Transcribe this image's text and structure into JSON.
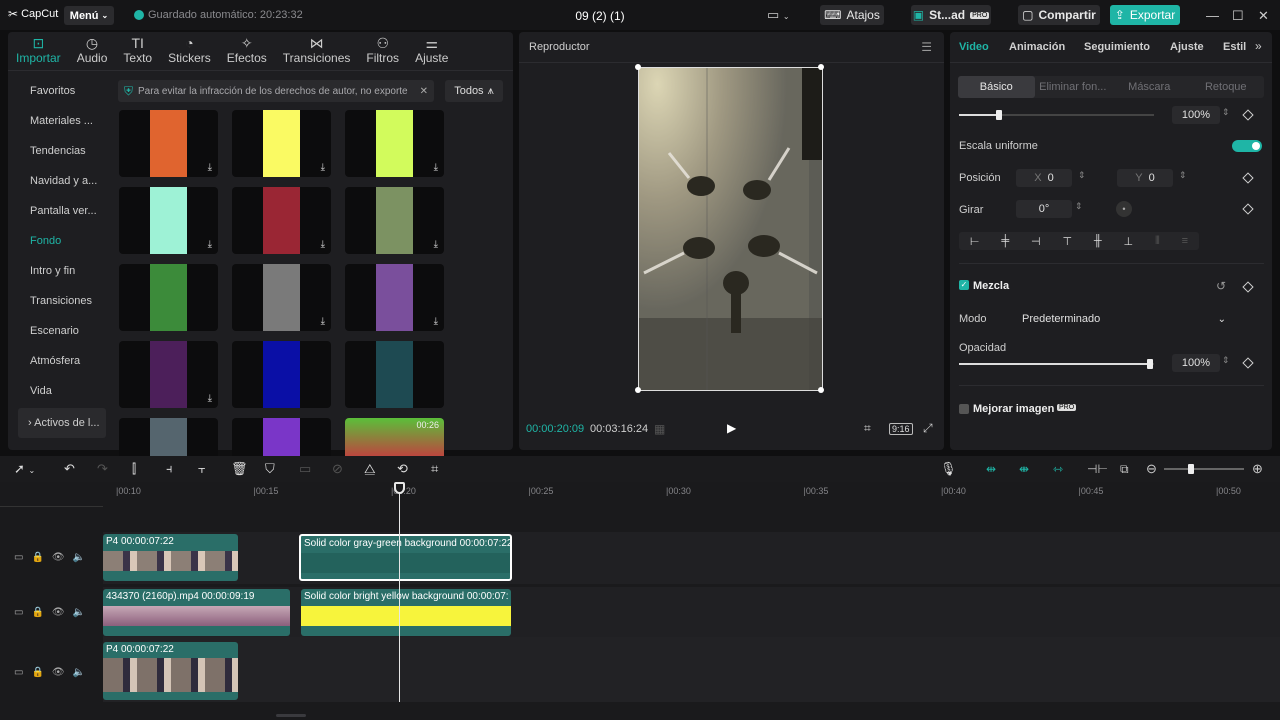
{
  "topbar": {
    "logo": "CapCut",
    "menu": "Menú",
    "autosave": "Guardado automático: 20:23:32",
    "project": "09 (2) (1)",
    "shortcuts": "Atajos",
    "studio": "St...ad",
    "pro_badge": "PRO",
    "share": "Compartir",
    "export": "Exportar"
  },
  "media_tabs": [
    {
      "label": "Importar",
      "icon": "import-icon"
    },
    {
      "label": "Audio",
      "icon": "audio-icon"
    },
    {
      "label": "Texto",
      "icon": "text-icon"
    },
    {
      "label": "Stickers",
      "icon": "sticker-icon"
    },
    {
      "label": "Efectos",
      "icon": "effects-icon"
    },
    {
      "label": "Transiciones",
      "icon": "transitions-icon"
    },
    {
      "label": "Filtros",
      "icon": "filters-icon"
    },
    {
      "label": "Ajuste",
      "icon": "adjust-icon"
    }
  ],
  "sidebar": [
    "Favoritos",
    "Materiales ...",
    "Tendencias",
    "Navidad y a...",
    "Pantalla ver...",
    "Fondo",
    "Intro y fin",
    "Transiciones",
    "Escenario",
    "Atmósfera",
    "Vida",
    "Activos de l..."
  ],
  "sidebar_active": "Fondo",
  "notice": "Para evitar la infracción de los derechos de autor, no exporte",
  "filter_all": "Todos",
  "swatches": [
    {
      "color": "#e0642f",
      "download": true
    },
    {
      "color": "#fafa63",
      "download": true
    },
    {
      "color": "#d2fb5c",
      "download": true
    },
    {
      "color": "#9ef2d6",
      "download": true
    },
    {
      "color": "#9a2634",
      "download": true
    },
    {
      "color": "#7c9262",
      "download": true
    },
    {
      "color": "#3c8b3a",
      "download": false
    },
    {
      "color": "#7a7a7a",
      "download": true
    },
    {
      "color": "#7a4f9c",
      "download": true
    },
    {
      "color": "#4c1f5a",
      "download": true
    },
    {
      "color": "#0a0fa6",
      "download": false
    },
    {
      "color": "#1e4a52",
      "download": false
    },
    {
      "color": "#55656e",
      "download": false
    },
    {
      "color": "#7a36c8",
      "download": false
    },
    {
      "color": "#4c9a3c",
      "download": false,
      "duration": "00:26"
    }
  ],
  "player": {
    "title": "Reproductor",
    "current_time": "00:00:20:09",
    "total_time": "00:03:16:24",
    "ratio": "9:16"
  },
  "inspector": {
    "tabs": [
      "Video",
      "Animación",
      "Seguimiento",
      "Ajuste",
      "Estil"
    ],
    "active_tab": "Video",
    "subtabs": [
      "Básico",
      "Eliminar fon...",
      "Máscara",
      "Retoque"
    ],
    "active_subtab": "Básico",
    "scale_value": "100%",
    "scale_level": 0.1,
    "uniform_scale": "Escala uniforme",
    "position_label": "Posición",
    "x_label": "X",
    "x_value": "0",
    "y_label": "Y",
    "y_value": "0",
    "rotate_label": "Girar",
    "rotate_value": "0°",
    "blend_title": "Mezcla",
    "mode_label": "Modo",
    "mode_value": "Predeterminado",
    "opacity_label": "Opacidad",
    "opacity_value": "100%",
    "opacity_level": 1.0,
    "enhance": "Mejorar imagen",
    "enhance_badge": "PRO"
  },
  "timeline": {
    "ticks": [
      "00:10",
      "00:15",
      "00:20",
      "00:25",
      "00:30",
      "00:35",
      "00:40",
      "00:45",
      "00:50"
    ],
    "clips": {
      "v1a_label": "P4  00:00:07:22",
      "v1b_label": "Solid color gray-green background  00:00:07:22",
      "v2a_label": "434370 (2160p).mp4  00:00:09:19",
      "v2b_label": "Solid color bright yellow background  00:00:07:",
      "v3a_label": "P4  00:00:07:22"
    }
  }
}
